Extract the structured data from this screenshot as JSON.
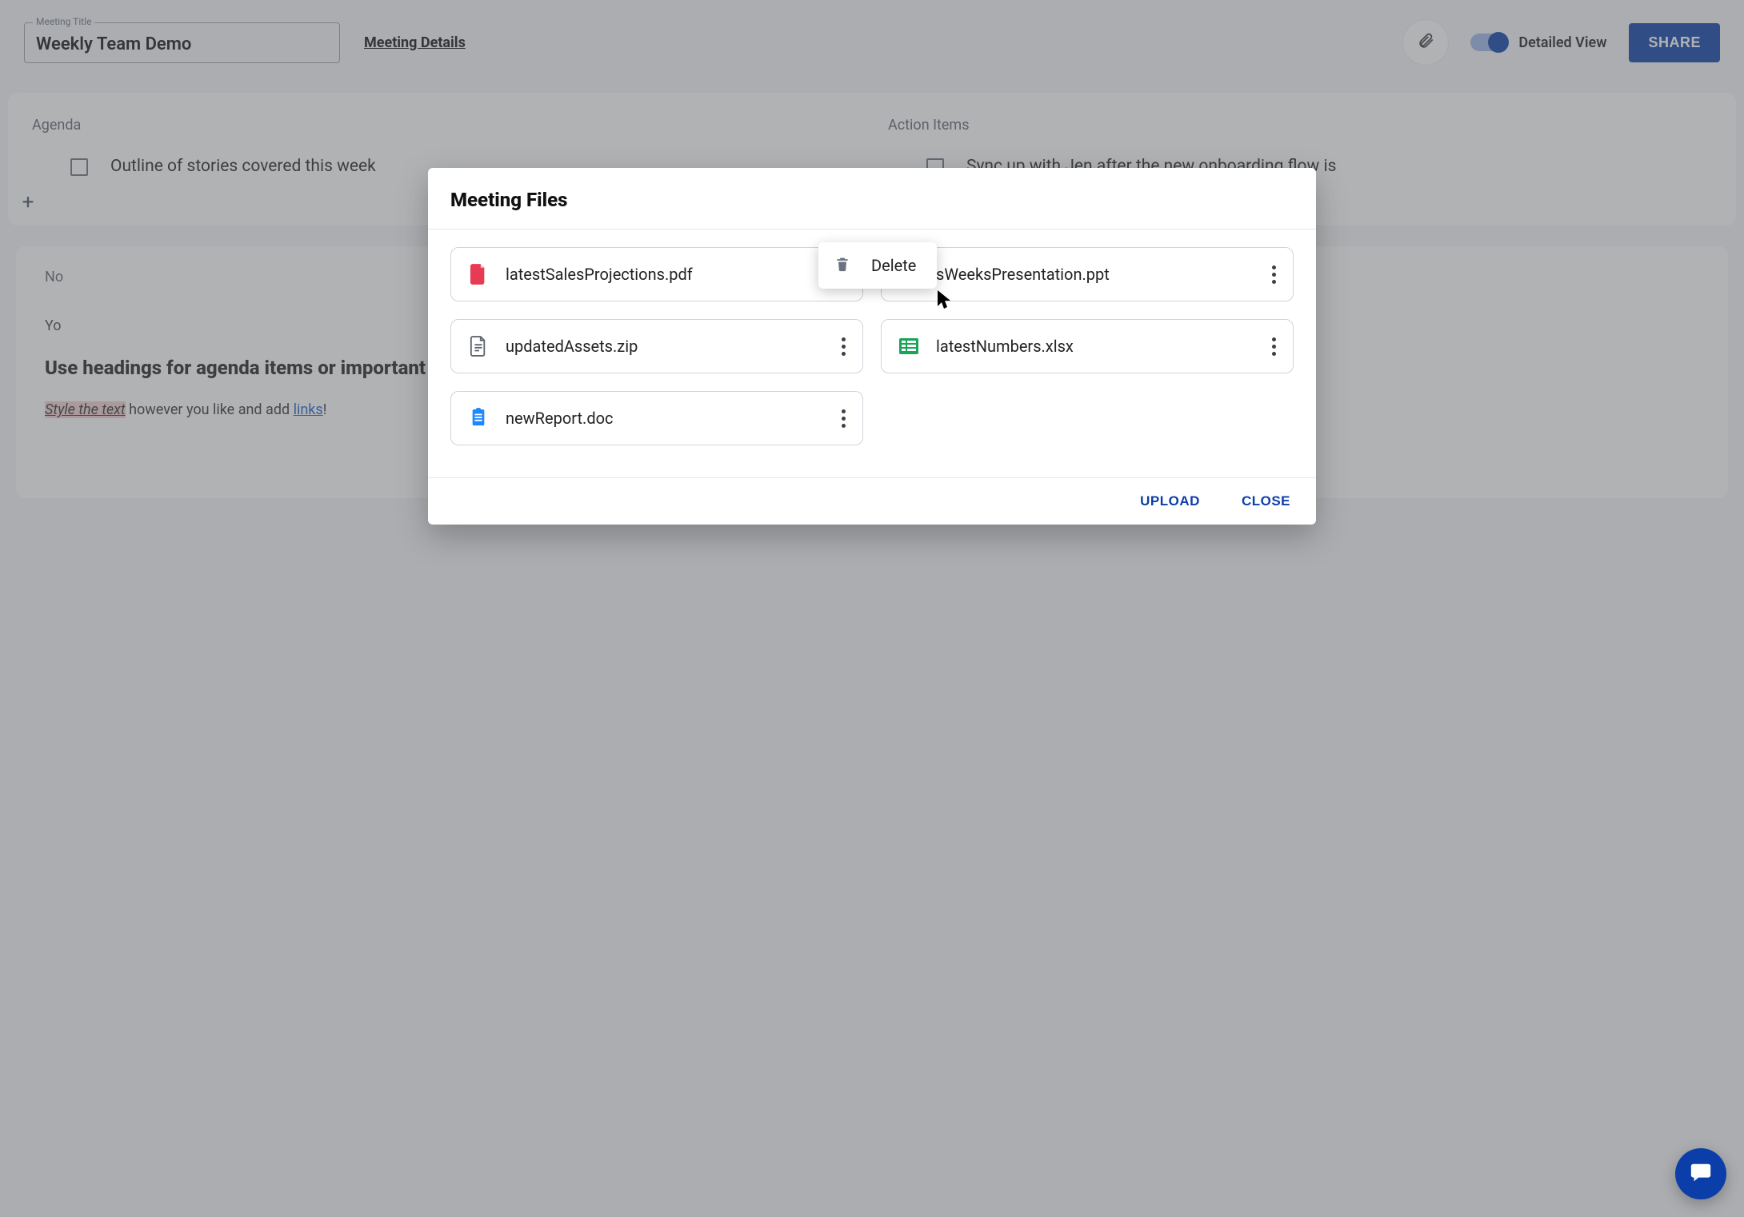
{
  "header": {
    "title_label": "Meeting Title",
    "title_value": "Weekly Team Demo",
    "details_link": "Meeting Details",
    "toggle_label": "Detailed View",
    "share_label": "SHARE"
  },
  "agenda": {
    "title": "Agenda",
    "items": [
      "Outline of stories covered this week"
    ]
  },
  "action_items": {
    "title": "Action Items",
    "items": [
      "Sync up with Jen after the new onboarding flow is"
    ]
  },
  "notes": {
    "section_label": "No",
    "line1_prefix": "Yo",
    "heading": "Use headings for agenda items or important points.",
    "styled_span": "Style the text",
    "line3_mid": " however you like and add ",
    "link_text": "links",
    "line3_tail": "!"
  },
  "dialog": {
    "title": "Meeting Files",
    "files": [
      {
        "name": "latestSalesProjections.pdf",
        "icon": "pdf"
      },
      {
        "name": "sWeeksPresentation.ppt",
        "icon": "ppt"
      },
      {
        "name": "updatedAssets.zip",
        "icon": "zip"
      },
      {
        "name": "latestNumbers.xlsx",
        "icon": "xlsx"
      },
      {
        "name": "newReport.doc",
        "icon": "doc"
      }
    ],
    "popover_label": "Delete",
    "upload_label": "UPLOAD",
    "close_label": "CLOSE"
  }
}
